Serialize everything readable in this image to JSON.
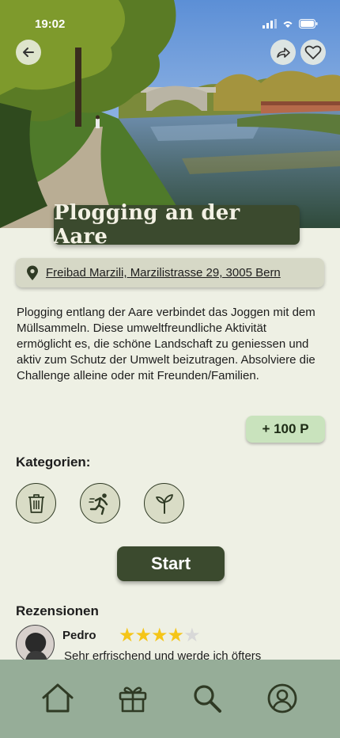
{
  "status_bar": {
    "time": "19:02"
  },
  "challenge": {
    "title": "Plogging an der Aare",
    "address": "Freibad Marzili, Marzilistrasse 29, 3005 Bern",
    "description": "Plogging entlang der Aare verbindet das Joggen mit dem Müllsammeln. Diese umweltfreundliche Aktivität ermöglicht es, die schöne Landschaft zu geniessen und aktiv zum Schutz der Umwelt beizutragen. Absolviere die Challenge alleine oder mit Freunden/Familien.",
    "points": "+ 100 P"
  },
  "categories": {
    "label": "Kategorien:",
    "items": [
      {
        "icon": "trash-icon"
      },
      {
        "icon": "running-icon"
      },
      {
        "icon": "plant-icon"
      }
    ]
  },
  "start_label": "Start",
  "reviews": {
    "label": "Rezensionen",
    "items": [
      {
        "name": "Pedro",
        "rating": 4,
        "max_rating": 5,
        "text": "Sehr erfrischend und werde ich öfters"
      }
    ]
  },
  "nav": [
    "home-icon",
    "gift-icon",
    "search-icon",
    "profile-icon"
  ],
  "colors": {
    "primary": "#3b4a2e",
    "background": "#eef0e4",
    "nav": "#96ad98",
    "points": "#c9e3bd",
    "star": "#f5c518"
  }
}
